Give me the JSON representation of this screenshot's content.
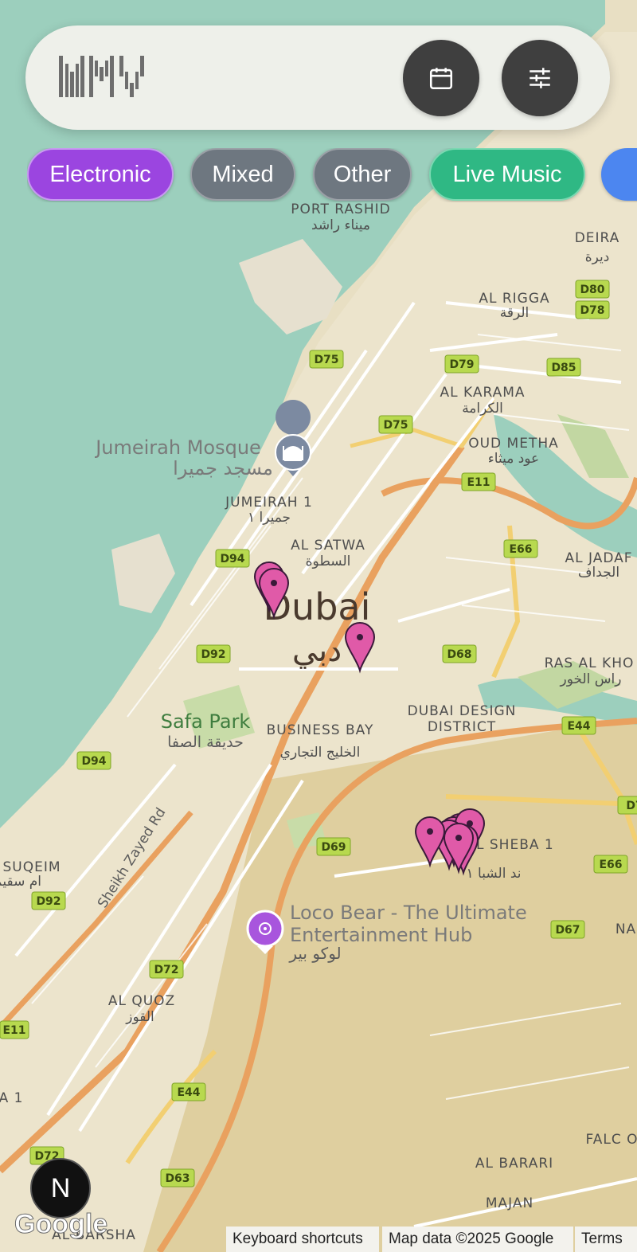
{
  "header": {
    "logo_text": "WMV",
    "calendar_icon": "calendar-icon",
    "filter_icon": "sliders-icon"
  },
  "chips": [
    {
      "label": "Electronic",
      "color": "#9b45e0"
    },
    {
      "label": "Mixed",
      "color": "#6e7780"
    },
    {
      "label": "Other",
      "color": "#6e7780"
    },
    {
      "label": "Live Music",
      "color": "#2fb884"
    },
    {
      "label": "",
      "color": "#4c86f0"
    }
  ],
  "map": {
    "city": "Dubai",
    "city_ar": "دبي",
    "areas": [
      {
        "name": "PORT RASHID",
        "ar": "ميناء راشد"
      },
      {
        "name": "DEIRA",
        "ar": "ديرة"
      },
      {
        "name": "AL RIGGA",
        "ar": "الرقة"
      },
      {
        "name": "AL KARAMA",
        "ar": "الكرامة"
      },
      {
        "name": "OUD METHA",
        "ar": "عود ميثاء"
      },
      {
        "name": "JUMEIRAH 1",
        "ar": "جميرا ١"
      },
      {
        "name": "AL SATWA",
        "ar": "السطوة"
      },
      {
        "name": "AL JADAF",
        "ar": "الجداف"
      },
      {
        "name": "RAS AL KHO",
        "ar": "راس الخور"
      },
      {
        "name": "DUBAI DESIGN",
        "ar": "DISTRICT"
      },
      {
        "name": "BUSINESS BAY",
        "ar": "الخليج التجاري"
      },
      {
        "name": "AL QUOZ",
        "ar": "القوز"
      },
      {
        "name": "SUQEIM",
        "ar": "ام سقيم"
      },
      {
        "name": "AD AL SHEBA 1",
        "ar": "ند الشبا ١"
      },
      {
        "name": "AL BARARI",
        "ar": ""
      },
      {
        "name": "MAJAN",
        "ar": ""
      },
      {
        "name": "AL BARSHA",
        "ar": ""
      },
      {
        "name": "NA",
        "ar": ""
      },
      {
        "name": "A 1",
        "ar": ""
      },
      {
        "name": "FALC OF W",
        "ar": ""
      }
    ],
    "pois": [
      {
        "name": "Jumeirah Mosque",
        "ar": "مسجد جميرا",
        "icon": "mosque-icon"
      },
      {
        "name": "Safa Park",
        "ar": "حديقة الصفا",
        "icon": ""
      },
      {
        "name": "Loco Bear - The Ultimate",
        "line2": "Entertainment Hub",
        "ar": "لوكو بير",
        "icon": "entertainment-icon"
      }
    ],
    "road_badges": [
      "D75",
      "D79",
      "D85",
      "D80",
      "D78",
      "D75",
      "E11",
      "E66",
      "D94",
      "D92",
      "D68",
      "E44",
      "D94",
      "D69",
      "E66",
      "D7",
      "D92",
      "D72",
      "D67",
      "E11",
      "E44",
      "D72",
      "D63"
    ],
    "road_name": "Sheikh Zayed Rd",
    "pin_color": "#e05aa8"
  },
  "controls": {
    "n_button": "N"
  },
  "attribution": {
    "google": "Google",
    "keyboard": "Keyboard shortcuts",
    "data": "Map data ©2025 Google",
    "terms": "Terms"
  }
}
